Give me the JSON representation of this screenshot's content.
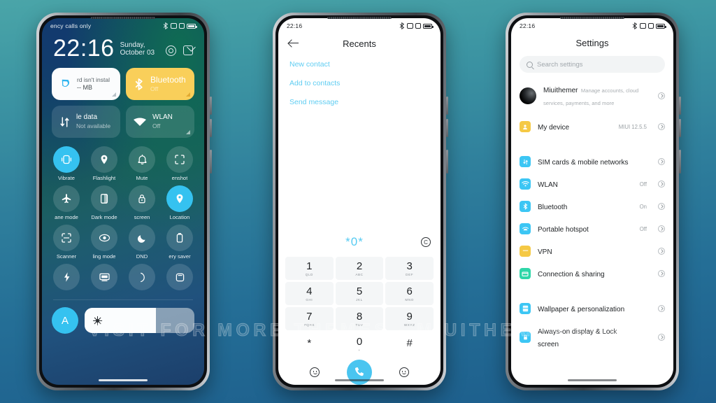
{
  "background": {
    "top_color": "#4aa5a8",
    "bottom_color": "#1d5e8c"
  },
  "watermark": {
    "text": "VISIT  FOR  MORE  THEMES  -  MIUITHEMER.COM"
  },
  "accent": {
    "cyan": "#35c2f0",
    "amber": "#f9cf5a",
    "link": "#5fcdf2"
  },
  "phone1": {
    "status": {
      "carrier": "ency calls only",
      "icons": [
        "bluetooth-icon",
        "alarm-icon",
        "screenshot-icon",
        "battery-icon"
      ]
    },
    "clock": {
      "time": "22:16",
      "date": "Sunday, October 03"
    },
    "clock_actions": [
      {
        "name": "camera-shortcut-icon"
      },
      {
        "name": "edit-shortcut-icon"
      }
    ],
    "big_tiles": [
      {
        "name": "storage-tile",
        "title": "rd isn't instal",
        "sub": "-- MB",
        "style": "light",
        "icon": "water-drop-icon"
      },
      {
        "name": "bluetooth-tile",
        "title": "Bluetooth",
        "sub": "Off",
        "style": "amber",
        "icon": "bluetooth-icon"
      },
      {
        "name": "mobile-data-tile",
        "title": "le data",
        "sub": "Not available",
        "style": "ghost",
        "icon": "mobile-data-icon"
      },
      {
        "name": "wlan-tile",
        "title": "WLAN",
        "sub": "Off",
        "style": "ghost",
        "icon": "wifi-icon"
      }
    ],
    "toggles": [
      {
        "label": "Vibrate",
        "icon": "vibrate-icon",
        "on": true
      },
      {
        "label": "Flashlight",
        "icon": "flashlight-icon",
        "on": false
      },
      {
        "label": "Mute",
        "icon": "bell-icon",
        "on": false
      },
      {
        "label": "enshot",
        "icon": "screenshot-icon",
        "on": false
      },
      {
        "label": "ane mode",
        "icon": "airplane-icon",
        "on": false
      },
      {
        "label": "Dark mode",
        "icon": "darkmode-icon",
        "on": false
      },
      {
        "label": "screen",
        "icon": "lock-icon",
        "on": false
      },
      {
        "label": "Location",
        "icon": "location-icon",
        "on": true
      },
      {
        "label": "Scanner",
        "icon": "scanner-icon",
        "on": false
      },
      {
        "label": "ling mode",
        "icon": "reading-eye-icon",
        "on": false
      },
      {
        "label": "DND",
        "icon": "moon-icon",
        "on": false
      },
      {
        "label": "ery saver",
        "icon": "battery-icon",
        "on": false
      },
      {
        "label": "",
        "icon": "bolt-icon",
        "on": false
      },
      {
        "label": "",
        "icon": "cast-icon",
        "on": false
      },
      {
        "label": "",
        "icon": "crescent-icon",
        "on": false
      },
      {
        "label": "",
        "icon": "square-icon",
        "on": false
      }
    ],
    "brightness": {
      "auto_label": "A",
      "level_percent": 65,
      "icon": "sun-icon"
    }
  },
  "phone2": {
    "status": {
      "time": "22:16",
      "icons": [
        "bluetooth-icon",
        "alarm-icon",
        "screenshot-icon",
        "battery-icon"
      ]
    },
    "header": {
      "back": "back-arrow-icon",
      "title": "Recents"
    },
    "suggestions": [
      "New contact",
      "Add to contacts",
      "Send message"
    ],
    "number_display": {
      "value": "*0*",
      "backspace": "backspace-icon"
    },
    "keypad": [
      {
        "digit": "1",
        "letters": "QLD"
      },
      {
        "digit": "2",
        "letters": "ABC"
      },
      {
        "digit": "3",
        "letters": "DEF"
      },
      {
        "digit": "4",
        "letters": "GHI"
      },
      {
        "digit": "5",
        "letters": "JKL"
      },
      {
        "digit": "6",
        "letters": "MNO"
      },
      {
        "digit": "7",
        "letters": "PQRS"
      },
      {
        "digit": "8",
        "letters": "TUV"
      },
      {
        "digit": "9",
        "letters": "WXYZ"
      },
      {
        "digit": "*",
        "letters": ""
      },
      {
        "digit": "0",
        "letters": "+"
      },
      {
        "digit": "#",
        "letters": ""
      }
    ],
    "bottom_bar": {
      "left_icon": "contacts-face-icon",
      "call_icon": "call-icon",
      "right_icon": "smiley-icon"
    }
  },
  "phone3": {
    "status": {
      "time": "22:16",
      "icons": [
        "bluetooth-icon",
        "alarm-icon",
        "screenshot-icon",
        "battery-icon"
      ]
    },
    "title": "Settings",
    "search": {
      "placeholder": "Search settings",
      "icon": "search-icon"
    },
    "account": {
      "name": "Miuithemer",
      "sub": "Manage accounts, cloud services, payments, and more",
      "icon": "avatar"
    },
    "rows": [
      {
        "label": "My device",
        "value": "MIUI 12.5.5",
        "icon": "device-icon",
        "color": "#f5c945",
        "gap_after": "big"
      },
      {
        "label": "SIM cards & mobile networks",
        "value": "",
        "icon": "sim-icon",
        "color": "#3cc6f4",
        "gap_after": "none"
      },
      {
        "label": "WLAN",
        "value": "Off",
        "icon": "wifi-icon",
        "color": "#3cc6f4",
        "gap_after": "none"
      },
      {
        "label": "Bluetooth",
        "value": "On",
        "icon": "bluetooth-icon",
        "color": "#3cc6f4",
        "gap_after": "none"
      },
      {
        "label": "Portable hotspot",
        "value": "Off",
        "icon": "hotspot-icon",
        "color": "#3cc6f4",
        "gap_after": "none"
      },
      {
        "label": "VPN",
        "value": "",
        "icon": "vpn-icon",
        "color": "#f5c945",
        "gap_after": "none"
      },
      {
        "label": "Connection & sharing",
        "value": "",
        "icon": "sharing-icon",
        "color": "#2fd6a8",
        "gap_after": "big"
      },
      {
        "label": "Wallpaper & personalization",
        "value": "",
        "icon": "wallpaper-icon",
        "color": "#3cc6f4",
        "gap_after": "none"
      },
      {
        "label": "Always-on display & Lock screen",
        "value": "",
        "icon": "aod-lock-icon",
        "color": "#3cc6f4",
        "gap_after": "none"
      }
    ]
  }
}
